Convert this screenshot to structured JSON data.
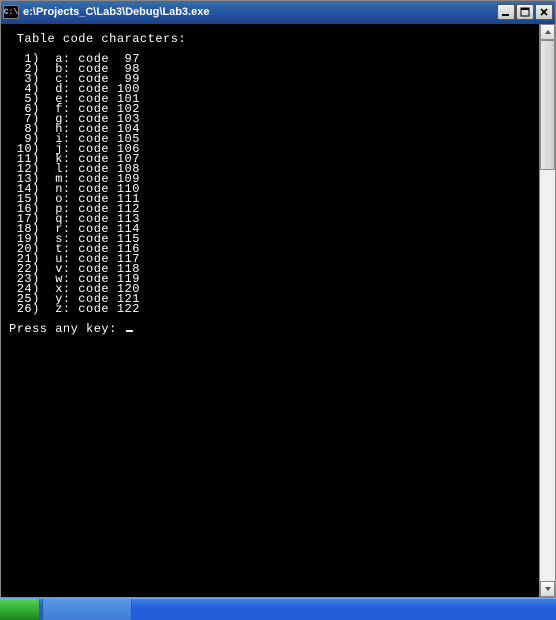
{
  "titlebar": {
    "icon_label": "C:\\",
    "path": "e:\\Projects_C\\Lab3\\Debug\\Lab3.exe"
  },
  "console": {
    "header": " Table code characters:",
    "rows": [
      {
        "idx": "  1)",
        "ch": "a",
        "code": " 97"
      },
      {
        "idx": "  2)",
        "ch": "b",
        "code": " 98"
      },
      {
        "idx": "  3)",
        "ch": "c",
        "code": " 99"
      },
      {
        "idx": "  4)",
        "ch": "d",
        "code": "100"
      },
      {
        "idx": "  5)",
        "ch": "e",
        "code": "101"
      },
      {
        "idx": "  6)",
        "ch": "f",
        "code": "102"
      },
      {
        "idx": "  7)",
        "ch": "g",
        "code": "103"
      },
      {
        "idx": "  8)",
        "ch": "h",
        "code": "104"
      },
      {
        "idx": "  9)",
        "ch": "i",
        "code": "105"
      },
      {
        "idx": " 10)",
        "ch": "j",
        "code": "106"
      },
      {
        "idx": " 11)",
        "ch": "k",
        "code": "107"
      },
      {
        "idx": " 12)",
        "ch": "l",
        "code": "108"
      },
      {
        "idx": " 13)",
        "ch": "m",
        "code": "109"
      },
      {
        "idx": " 14)",
        "ch": "n",
        "code": "110"
      },
      {
        "idx": " 15)",
        "ch": "o",
        "code": "111"
      },
      {
        "idx": " 16)",
        "ch": "p",
        "code": "112"
      },
      {
        "idx": " 17)",
        "ch": "q",
        "code": "113"
      },
      {
        "idx": " 18)",
        "ch": "r",
        "code": "114"
      },
      {
        "idx": " 19)",
        "ch": "s",
        "code": "115"
      },
      {
        "idx": " 20)",
        "ch": "t",
        "code": "116"
      },
      {
        "idx": " 21)",
        "ch": "u",
        "code": "117"
      },
      {
        "idx": " 22)",
        "ch": "v",
        "code": "118"
      },
      {
        "idx": " 23)",
        "ch": "w",
        "code": "119"
      },
      {
        "idx": " 24)",
        "ch": "x",
        "code": "120"
      },
      {
        "idx": " 25)",
        "ch": "y",
        "code": "121"
      },
      {
        "idx": " 26)",
        "ch": "z",
        "code": "122"
      }
    ],
    "prompt": "Press any key: "
  }
}
